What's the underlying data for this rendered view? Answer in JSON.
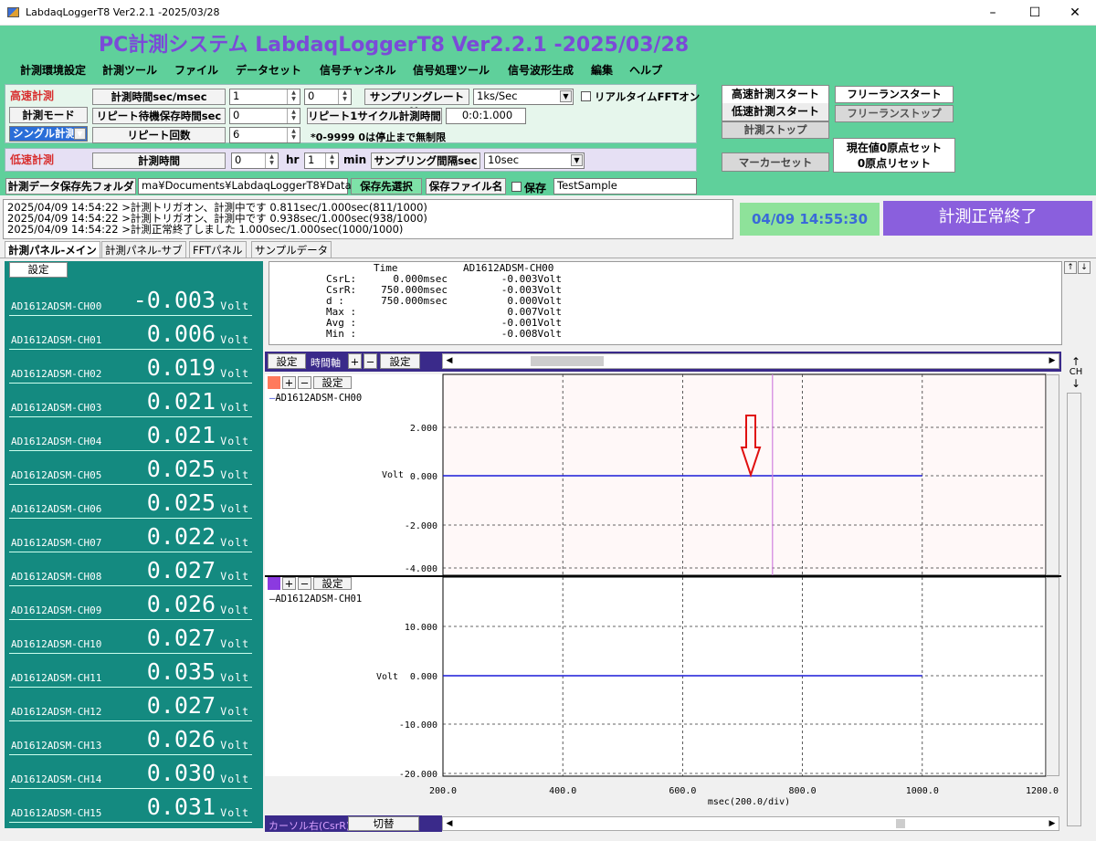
{
  "window": {
    "title": "LabdaqLoggerT8 Ver2.2.1 -2025/03/28",
    "app_title": "PC計測システム LabdaqLoggerT8 Ver2.2.1 -2025/03/28"
  },
  "menu": [
    "計測環境設定",
    "計測ツール",
    "ファイル",
    "データセット",
    "信号チャンネル",
    "信号処理ツール",
    "信号波形生成",
    "編集",
    "ヘルプ"
  ],
  "highspeed": {
    "label": "高速計測",
    "mode_button": "計測モード",
    "mode_value": "シングル計測",
    "time_label": "計測時間sec/msec",
    "time_sec": "1",
    "time_msec": "0",
    "repeat_wait_label": "リピート待機保存時間sec",
    "repeat_wait_value": "0",
    "repeat_count_label": "リピート回数",
    "repeat_count_value": "6",
    "sampling_rate_label": "サンプリングレートHz",
    "sampling_rate_value": "1ks/Sec",
    "realtime_fft_label": "リアルタイムFFTオン",
    "repeat_cycle_label": "リピート1サイクル計測時間",
    "repeat_cycle_value": "0:0:1.000",
    "note": "*0-9999 0は停止まで無制限"
  },
  "lowspeed": {
    "label": "低速計測",
    "time_label": "計測時間",
    "hr_value": "0",
    "hr_unit": "hr",
    "min_value": "1",
    "min_unit": "min",
    "interval_label": "サンプリング間隔sec",
    "interval_value": "10sec"
  },
  "save": {
    "folder_label": "計測データ保存先フォルダ",
    "folder_value": "ma¥Documents¥LabdaqLoggerT8¥Data",
    "select_button": "保存先選択",
    "filename_button": "保存ファイル名",
    "save_check_label": "保存",
    "filename_value": "TestSample"
  },
  "controls": {
    "hs_start": "高速計測スタート",
    "ls_start": "低速計測スタート",
    "stop": "計測ストップ",
    "freerun_start": "フリーランスタート",
    "freerun_stop": "フリーランストップ",
    "marker_set": "マーカーセット",
    "zero_set": "現在値0原点セット",
    "zero_reset": "0原点リセット"
  },
  "log": [
    "2025/04/09 14:54:22 >計測トリガオン、計測中です 0.811sec/1.000sec(811/1000)",
    "2025/04/09 14:54:22 >計測トリガオン、計測中です 0.938sec/1.000sec(938/1000)",
    "2025/04/09 14:54:22 >計測正常終了しました 1.000sec/1.000sec(1000/1000)"
  ],
  "clock": "04/09 14:55:30",
  "status": "計測正常終了",
  "tabs": [
    "計測パネル-メイン",
    "計測パネル-サブ",
    "FFTパネル",
    "サンプルデータ"
  ],
  "channel_panel": {
    "settings_button": "設定",
    "unit": "Volt",
    "channels": [
      {
        "name": "AD1612ADSM-CH00",
        "value": "-0.003"
      },
      {
        "name": "AD1612ADSM-CH01",
        "value": "0.006"
      },
      {
        "name": "AD1612ADSM-CH02",
        "value": "0.019"
      },
      {
        "name": "AD1612ADSM-CH03",
        "value": "0.021"
      },
      {
        "name": "AD1612ADSM-CH04",
        "value": "0.021"
      },
      {
        "name": "AD1612ADSM-CH05",
        "value": "0.025"
      },
      {
        "name": "AD1612ADSM-CH06",
        "value": "0.025"
      },
      {
        "name": "AD1612ADSM-CH07",
        "value": "0.022"
      },
      {
        "name": "AD1612ADSM-CH08",
        "value": "0.027"
      },
      {
        "name": "AD1612ADSM-CH09",
        "value": "0.026"
      },
      {
        "name": "AD1612ADSM-CH10",
        "value": "0.027"
      },
      {
        "name": "AD1612ADSM-CH11",
        "value": "0.035"
      },
      {
        "name": "AD1612ADSM-CH12",
        "value": "0.027"
      },
      {
        "name": "AD1612ADSM-CH13",
        "value": "0.026"
      },
      {
        "name": "AD1612ADSM-CH14",
        "value": "0.030"
      },
      {
        "name": "AD1612ADSM-CH15",
        "value": "0.031"
      }
    ]
  },
  "cursor_info": {
    "header_time": "Time",
    "header_ch": "AD1612ADSM-CH00",
    "rows": [
      {
        "label": "CsrL:",
        "time": "0.000msec",
        "value": "-0.003Volt"
      },
      {
        "label": "CsrR:",
        "time": "750.000msec",
        "value": "-0.003Volt"
      },
      {
        "label": "d    :",
        "time": "750.000msec",
        "value": "0.000Volt"
      },
      {
        "label": "Max :",
        "time": "",
        "value": "0.007Volt"
      },
      {
        "label": "Avg :",
        "time": "",
        "value": "-0.001Volt"
      },
      {
        "label": "Min :",
        "time": "",
        "value": "-0.008Volt"
      }
    ]
  },
  "graph_toolbar": {
    "settings": "設定",
    "time_axis": "時間軸",
    "plus": "+",
    "minus": "−",
    "settings2": "設定"
  },
  "graph1": {
    "color": "#ff7a5c",
    "settings": "設定",
    "legend": "AD1612ADSM-CH00",
    "ylabel": "Volt",
    "yticks": [
      "2.000",
      "0.000",
      "-2.000",
      "-4.000"
    ]
  },
  "graph2": {
    "color": "#8b3ae0",
    "settings": "設定",
    "legend": "AD1612ADSM-CH01",
    "ylabel": "Volt",
    "yticks": [
      "10.000",
      "0.000",
      "-10.000",
      "-20.000"
    ]
  },
  "xaxis": {
    "ticks": [
      "200.0",
      "400.0",
      "600.0",
      "800.0",
      "1000.0",
      "1200.0"
    ],
    "label": "msec(200.0/div)"
  },
  "bottom": {
    "cursor_label": "カーソル右(CsrR)",
    "switch_button": "切替"
  },
  "side_scroll": {
    "up": "↑",
    "down": "↓",
    "ch_label": "CH"
  },
  "chart_data": [
    {
      "type": "line",
      "series": [
        {
          "name": "AD1612ADSM-CH00",
          "x": [
            200,
            1000
          ],
          "y": [
            0.0,
            0.0
          ]
        }
      ],
      "xlim": [
        200,
        1200
      ],
      "ylim": [
        -4,
        4
      ],
      "ylabel": "Volt",
      "xlabel": "msec(200.0/div)",
      "cursor_x": 750,
      "grid": true
    },
    {
      "type": "line",
      "series": [
        {
          "name": "AD1612ADSM-CH01",
          "x": [
            200,
            1000
          ],
          "y": [
            0.0,
            0.0
          ]
        }
      ],
      "xlim": [
        200,
        1200
      ],
      "ylim": [
        -20,
        20
      ],
      "ylabel": "Volt",
      "xlabel": "msec(200.0/div)",
      "grid": true
    }
  ]
}
